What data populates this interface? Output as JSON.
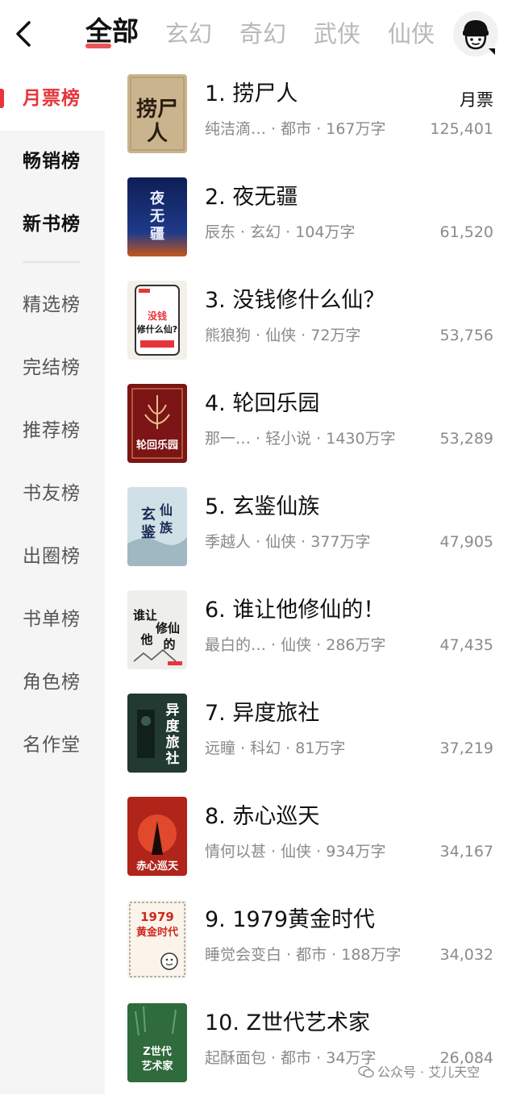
{
  "nav": {
    "back_icon": "chevron-left-icon",
    "tabs": [
      {
        "label": "全部",
        "active": true
      },
      {
        "label": "玄幻",
        "active": false
      },
      {
        "label": "奇幻",
        "active": false
      },
      {
        "label": "武侠",
        "active": false
      },
      {
        "label": "仙侠",
        "active": false
      }
    ],
    "avatar_icon": "user-avatar-icon",
    "accent_color": "#e8353b"
  },
  "sidebar": {
    "items": [
      {
        "label": "月票榜",
        "active": true
      },
      {
        "label": "畅销榜",
        "active": false
      },
      {
        "label": "新书榜",
        "active": false
      },
      {
        "label": "精选榜",
        "active": false
      },
      {
        "label": "完结榜",
        "active": false
      },
      {
        "label": "推荐榜",
        "active": false
      },
      {
        "label": "书友榜",
        "active": false
      },
      {
        "label": "出圈榜",
        "active": false
      },
      {
        "label": "书单榜",
        "active": false
      },
      {
        "label": "角色榜",
        "active": false
      },
      {
        "label": "名作堂",
        "active": false
      }
    ]
  },
  "list": {
    "column_label": "月票",
    "books": [
      {
        "title": "1. 捞尸人",
        "meta": "纯洁滴… · 都市 · 167万字",
        "count": "125,401",
        "cover_text": "捞尸人",
        "cover_color": "#c9b48e"
      },
      {
        "title": "2. 夜无疆",
        "meta": "辰东 · 玄幻 · 104万字",
        "count": "61,520",
        "cover_text": "夜无疆",
        "cover_color": "#1b2e6b"
      },
      {
        "title": "3. 没钱修什么仙？",
        "meta": "熊狼狗 · 仙侠 · 72万字",
        "count": "53,756",
        "cover_text": "没钱修什么仙?",
        "cover_color": "#f3efe9"
      },
      {
        "title": "4. 轮回乐园",
        "meta": "那一… · 轻小说 · 1430万字",
        "count": "53,289",
        "cover_text": "轮回乐园",
        "cover_color": "#7d1416"
      },
      {
        "title": "5. 玄鉴仙族",
        "meta": "季越人 · 仙侠 · 377万字",
        "count": "47,905",
        "cover_text": "玄鉴仙族",
        "cover_color": "#cfe0e6"
      },
      {
        "title": "6. 谁让他修仙的！",
        "meta": "最白的… · 仙侠 · 286万字",
        "count": "47,435",
        "cover_text": "谁让他修仙的",
        "cover_color": "#eeeeea"
      },
      {
        "title": "7. 异度旅社",
        "meta": "远瞳 · 科幻 · 81万字",
        "count": "37,219",
        "cover_text": "异度旅社",
        "cover_color": "#233a33"
      },
      {
        "title": "8. 赤心巡天",
        "meta": "情何以甚 · 仙侠 · 934万字",
        "count": "34,167",
        "cover_text": "赤心巡天",
        "cover_color": "#b1241a"
      },
      {
        "title": "9. 1979黄金时代",
        "meta": "睡觉会变白 · 都市 · 188万字",
        "count": "34,032",
        "cover_text": "1979黄金时代",
        "cover_color": "#faf4ea"
      },
      {
        "title": "10. Z世代艺术家",
        "meta": "起酥面包 · 都市 · 34万字",
        "count": "26,084",
        "cover_text": "Z世代艺术家",
        "cover_color": "#2f6b3c"
      }
    ]
  },
  "watermark": {
    "text": "公众号 · 艾儿天空",
    "icon": "wechat-icon"
  }
}
